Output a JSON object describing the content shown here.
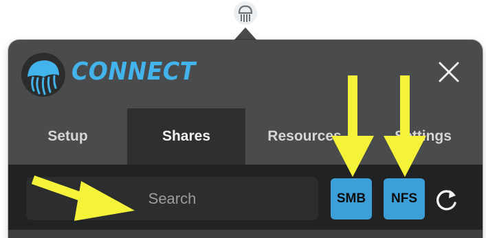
{
  "app": {
    "brand_name": "CONNECT"
  },
  "tabs": [
    {
      "label": "Setup",
      "active": false
    },
    {
      "label": "Shares",
      "active": true
    },
    {
      "label": "Resources",
      "active": false
    },
    {
      "label": "Settings",
      "active": false
    }
  ],
  "toolbar": {
    "search_placeholder": "Search",
    "smb_label": "SMB",
    "nfs_label": "NFS"
  },
  "colors": {
    "accent": "#3d9fd8",
    "brand_text": "#43b3ec",
    "annotation_arrow": "#f5f23a"
  },
  "icons": [
    "jellyfish-menubar-icon",
    "jellyfish-logo-icon",
    "close-icon",
    "refresh-icon"
  ]
}
